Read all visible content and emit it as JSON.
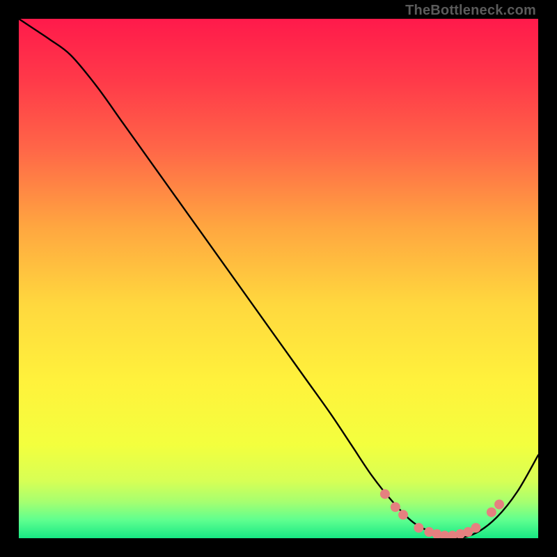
{
  "attribution": "TheBottleneck.com",
  "chart_data": {
    "type": "line",
    "title": "",
    "xlabel": "",
    "ylabel": "",
    "xlim": [
      0,
      100
    ],
    "ylim": [
      0,
      100
    ],
    "series": [
      {
        "name": "bottleneck-curve",
        "x": [
          0,
          3,
          6,
          10,
          15,
          20,
          25,
          30,
          35,
          40,
          45,
          50,
          55,
          60,
          64,
          68,
          72,
          76,
          80,
          84,
          88,
          92,
          96,
          100
        ],
        "y": [
          100,
          98,
          96,
          93,
          87,
          80,
          73,
          66,
          59,
          52,
          45,
          38,
          31,
          24,
          18,
          12,
          7,
          3,
          1,
          0,
          1,
          4,
          9,
          16
        ]
      }
    ],
    "markers": {
      "name": "highlight-dots",
      "color": "#e58080",
      "points": [
        {
          "x": 70.5,
          "y": 8.5
        },
        {
          "x": 72.5,
          "y": 6.0
        },
        {
          "x": 74.0,
          "y": 4.5
        },
        {
          "x": 77.0,
          "y": 2.0
        },
        {
          "x": 79.0,
          "y": 1.2
        },
        {
          "x": 80.5,
          "y": 0.8
        },
        {
          "x": 82.0,
          "y": 0.5
        },
        {
          "x": 83.5,
          "y": 0.5
        },
        {
          "x": 85.0,
          "y": 0.8
        },
        {
          "x": 86.5,
          "y": 1.2
        },
        {
          "x": 88.0,
          "y": 2.0
        },
        {
          "x": 91.0,
          "y": 5.0
        },
        {
          "x": 92.5,
          "y": 6.5
        }
      ]
    },
    "gradient_stops": [
      {
        "offset": 0.0,
        "color": "#ff1a4b"
      },
      {
        "offset": 0.12,
        "color": "#ff3a49"
      },
      {
        "offset": 0.25,
        "color": "#ff6648"
      },
      {
        "offset": 0.4,
        "color": "#ffa640"
      },
      {
        "offset": 0.55,
        "color": "#ffd83e"
      },
      {
        "offset": 0.7,
        "color": "#fff23c"
      },
      {
        "offset": 0.82,
        "color": "#f3ff3e"
      },
      {
        "offset": 0.89,
        "color": "#d7ff55"
      },
      {
        "offset": 0.93,
        "color": "#a6ff70"
      },
      {
        "offset": 0.965,
        "color": "#5fff8f"
      },
      {
        "offset": 1.0,
        "color": "#17e884"
      }
    ]
  }
}
